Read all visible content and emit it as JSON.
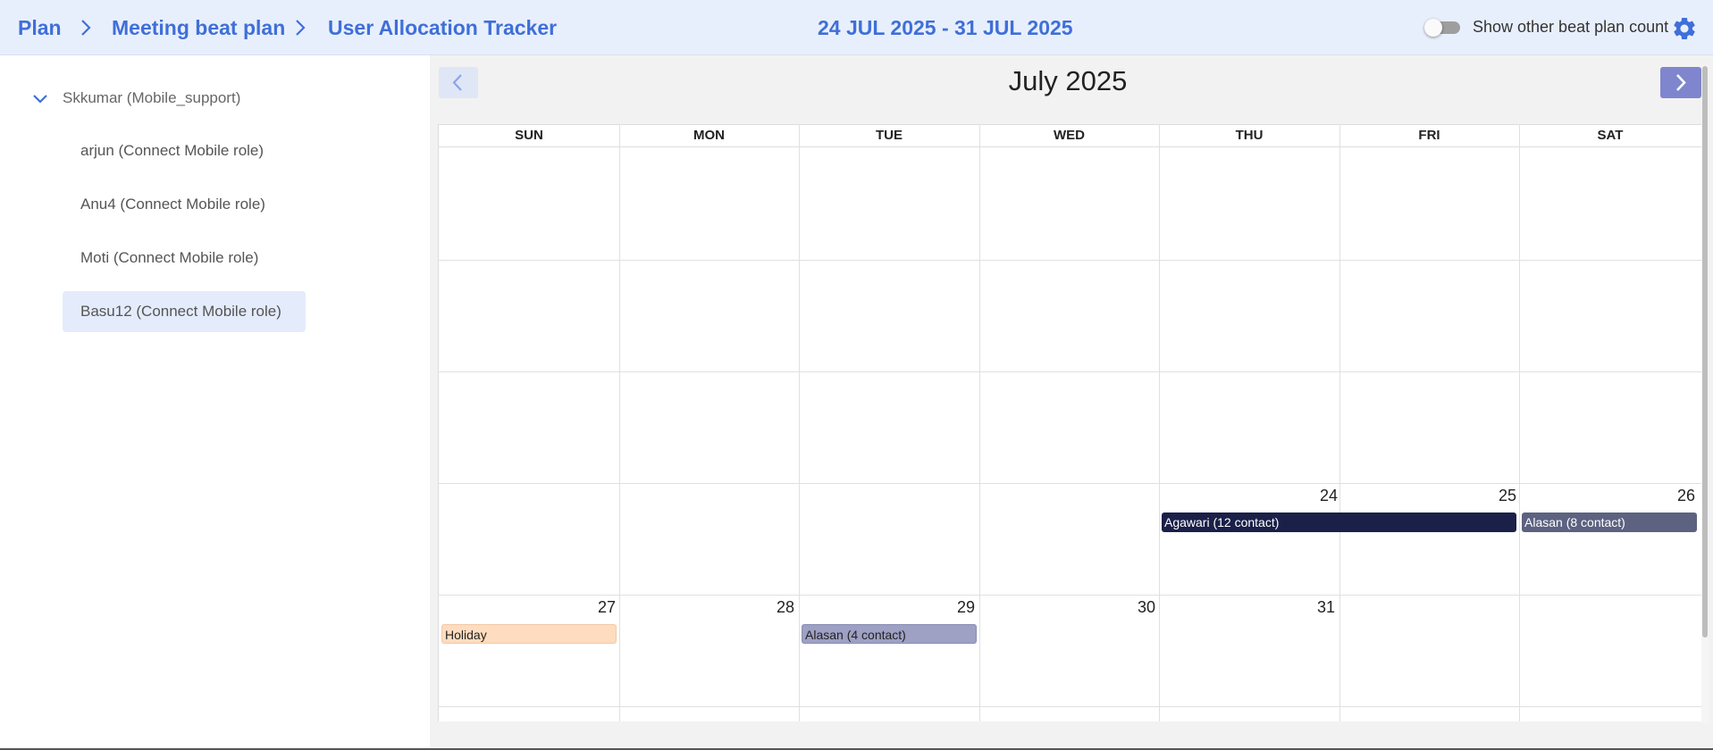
{
  "breadcrumb": {
    "items": [
      "Plan",
      "Meeting beat plan",
      "User Allocation Tracker"
    ]
  },
  "header": {
    "date_range": "24 JUL 2025 - 31 JUL 2025",
    "toggle_label": "Show other beat plan count",
    "toggle_on": false
  },
  "sidebar": {
    "root": "Skkumar (Mobile_support)",
    "items": [
      "arjun (Connect Mobile role)",
      "Anu4 (Connect Mobile role)",
      "Moti (Connect Mobile role)",
      "Basu12 (Connect Mobile role)"
    ],
    "selected_index": 3
  },
  "calendar": {
    "month_title": "July 2025",
    "weekdays": [
      "SUN",
      "MON",
      "TUE",
      "WED",
      "THU",
      "FRI",
      "SAT"
    ],
    "day_numbers": {
      "24": "24",
      "25": "25",
      "26": "26",
      "27": "27",
      "28": "28",
      "29": "29",
      "30": "30",
      "31": "31"
    },
    "events": [
      {
        "label": "Agawari (12 contact)",
        "start": "24",
        "end": "25",
        "color": "#1a2048",
        "text_color": "#ffffff"
      },
      {
        "label": "Alasan (8 contact)",
        "start": "26",
        "end": "26",
        "color": "#5c6280",
        "text_color": "#ffffff"
      },
      {
        "label": "Holiday",
        "start": "27",
        "end": "27",
        "color": "#fddcbf",
        "text_color": "#222222"
      },
      {
        "label": "Alasan (4 contact)",
        "start": "29",
        "end": "29",
        "color": "#9ea0c4",
        "text_color": "#222222"
      }
    ]
  },
  "colors": {
    "accent": "#3f6fd8",
    "header_bg": "#e8effc",
    "selected_bg": "#e4ecfc",
    "next_button": "#7f86cd"
  }
}
